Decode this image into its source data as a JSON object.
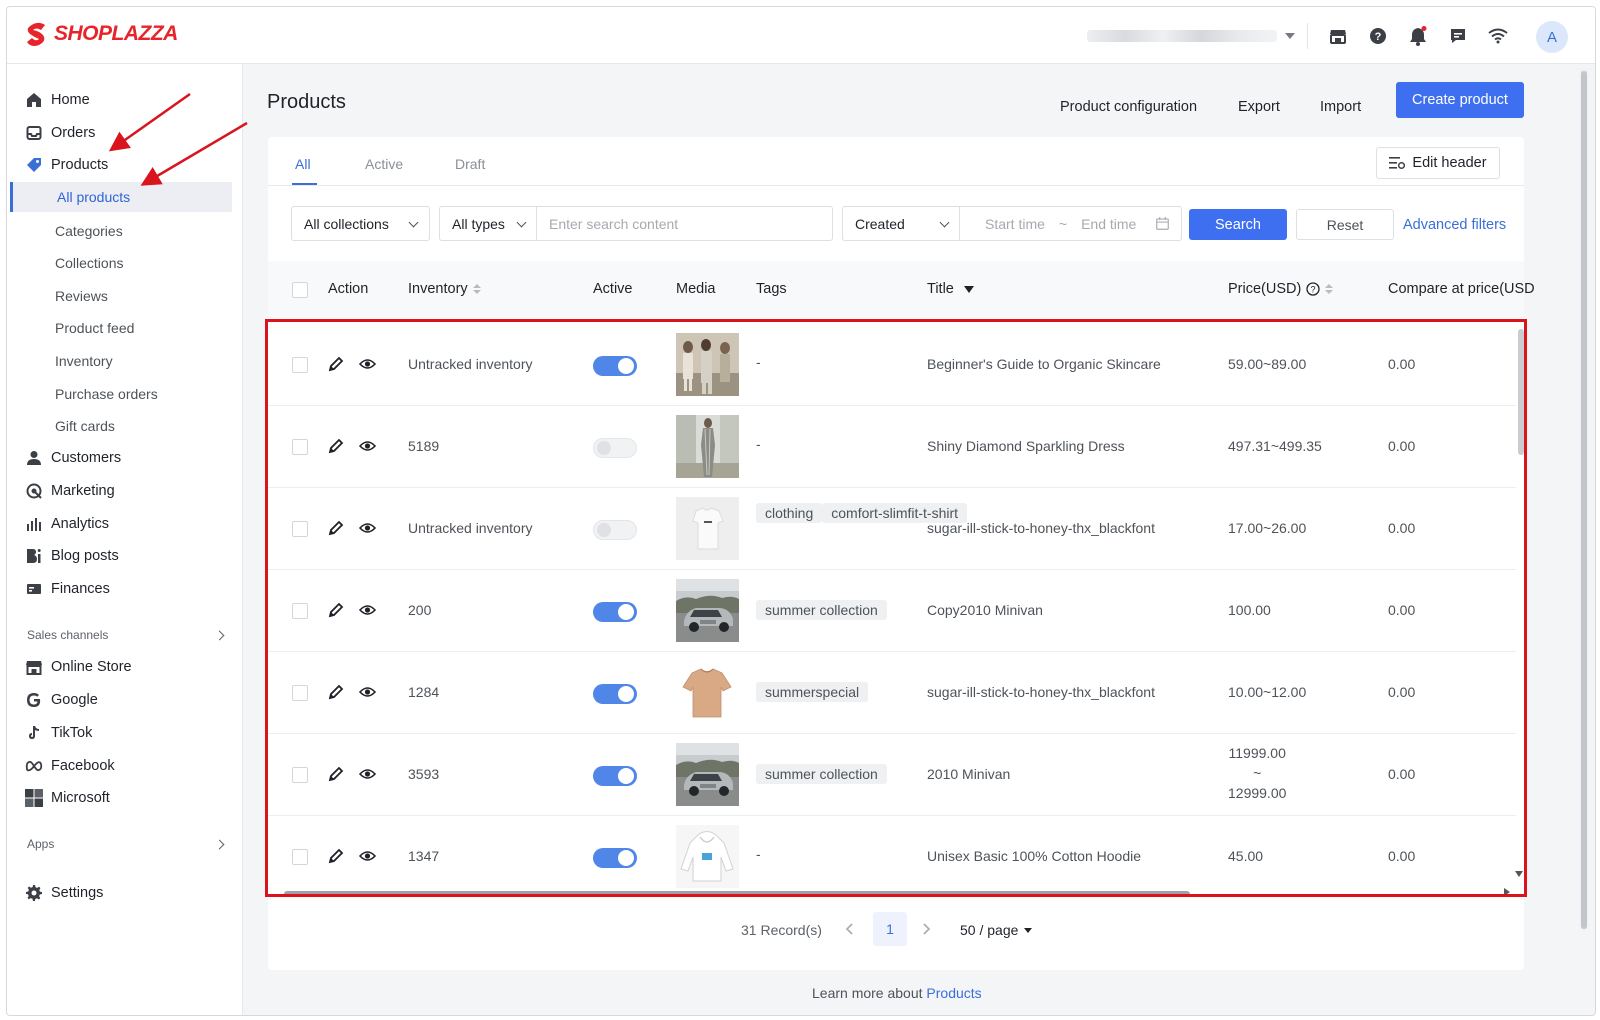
{
  "brand": {
    "name": "SHOPLAZZA",
    "color": "#e8242b"
  },
  "topbar": {
    "icons": [
      "store-icon",
      "help-icon",
      "bell-icon",
      "chat-icon",
      "wifi-icon"
    ],
    "avatar": "A"
  },
  "sidebar": {
    "items": [
      {
        "label": "Home",
        "icon": "home-icon"
      },
      {
        "label": "Orders",
        "icon": "orders-icon"
      },
      {
        "label": "Products",
        "icon": "tag-icon"
      }
    ],
    "products_sub": [
      "All products",
      "Categories",
      "Collections",
      "Reviews",
      "Product feed",
      "Inventory",
      "Purchase orders",
      "Gift cards"
    ],
    "items2": [
      {
        "label": "Customers",
        "icon": "customer-icon"
      },
      {
        "label": "Marketing",
        "icon": "marketing-icon"
      },
      {
        "label": "Analytics",
        "icon": "analytics-icon"
      },
      {
        "label": "Blog posts",
        "icon": "blog-icon"
      },
      {
        "label": "Finances",
        "icon": "finances-icon"
      }
    ],
    "sales_channels_label": "Sales channels",
    "channels": [
      {
        "label": "Online Store",
        "icon": "store-icon"
      },
      {
        "label": "Google",
        "icon": "google-icon"
      },
      {
        "label": "TikTok",
        "icon": "tiktok-icon"
      },
      {
        "label": "Facebook",
        "icon": "meta-icon"
      },
      {
        "label": "Microsoft",
        "icon": "microsoft-icon"
      }
    ],
    "apps_label": "Apps",
    "settings_label": "Settings"
  },
  "header": {
    "title": "Products",
    "links": [
      "Product configuration",
      "Export",
      "Import"
    ],
    "create_button": "Create product"
  },
  "tabs": [
    "All",
    "Active",
    "Draft"
  ],
  "edit_header": "Edit header",
  "filters": {
    "collections": "All collections",
    "types": "All types",
    "search_placeholder": "Enter search content",
    "date_field": "Created",
    "start_placeholder": "Start time",
    "range_sep": "~",
    "end_placeholder": "End time",
    "search_button": "Search",
    "reset_button": "Reset",
    "advanced": "Advanced filters"
  },
  "table": {
    "columns": [
      "Action",
      "Inventory",
      "Active",
      "Media",
      "Tags",
      "Title",
      "Price(USD)",
      "Compare at price(USD"
    ],
    "rows": [
      {
        "inventory": "Untracked inventory",
        "active": true,
        "tags": [
          "-"
        ],
        "title": "Beginner's Guide to Organic Skincare",
        "price": "59.00~89.00",
        "compare": "0.00",
        "media": "models"
      },
      {
        "inventory": "5189",
        "active": false,
        "tags": [
          "-"
        ],
        "title": "Shiny Diamond Sparkling Dress",
        "price": "497.31~499.35",
        "compare": "0.00",
        "media": "dress"
      },
      {
        "inventory": "Untracked inventory",
        "active": false,
        "tags": [
          "clothing",
          "comfort-slimfit-t-shirt"
        ],
        "title": "sugar-ill-stick-to-honey-thx_blackfont",
        "price": "17.00~26.00",
        "compare": "0.00",
        "media": "tshirt"
      },
      {
        "inventory": "200",
        "active": true,
        "tags": [
          "summer collection"
        ],
        "title": "Copy2010 Minivan",
        "price": "100.00",
        "compare": "0.00",
        "media": "car"
      },
      {
        "inventory": "1284",
        "active": true,
        "tags": [
          "summerspecial"
        ],
        "title": "sugar-ill-stick-to-honey-thx_blackfont",
        "price": "10.00~12.00",
        "compare": "0.00",
        "media": "tee"
      },
      {
        "inventory": "3593",
        "active": true,
        "tags": [
          "summer collection"
        ],
        "title": "2010 Minivan",
        "price_lines": [
          "11999.00",
          "~",
          "12999.00"
        ],
        "compare": "0.00",
        "media": "car"
      },
      {
        "inventory": "1347",
        "active": true,
        "tags": [
          "-"
        ],
        "title": "Unisex Basic 100% Cotton Hoodie",
        "price": "45.00",
        "compare": "0.00",
        "media": "hoodie"
      }
    ]
  },
  "pagination": {
    "records": "31 Record(s)",
    "page": "1",
    "per_page": "50 / page"
  },
  "footer": {
    "text": "Learn more about ",
    "link": "Products"
  }
}
